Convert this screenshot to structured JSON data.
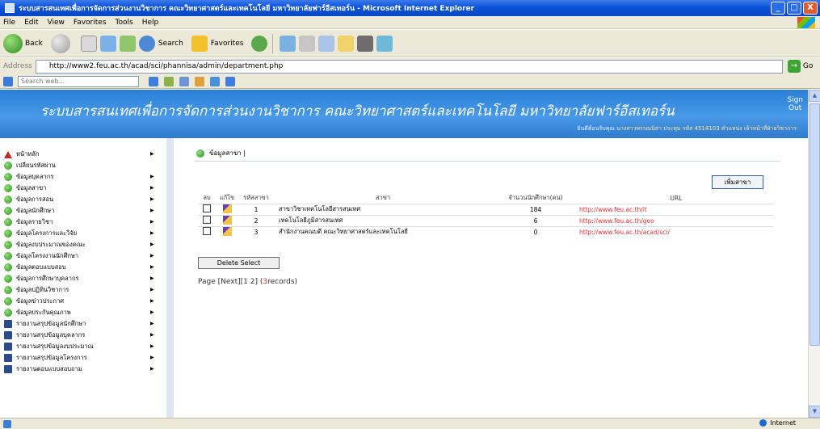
{
  "window": {
    "title": "ระบบสารสนเทศเพื่อการจัดการส่วนงานวิชาการ คณะวิทยาศาสตร์และเทคโนโลยี มหาวิทยาลัยฟาร์อีสเทอร์น - Microsoft Internet Explorer",
    "minimize": "_",
    "maximize": "□",
    "close": "X"
  },
  "menubar": [
    "File",
    "Edit",
    "View",
    "Favorites",
    "Tools",
    "Help"
  ],
  "toolbar": {
    "back": "Back",
    "search": "Search",
    "favorites": "Favorites"
  },
  "address": {
    "label": "Address",
    "url": "http://www2.feu.ac.th/acad/sci/phannisa/admin/department.php",
    "go": "Go"
  },
  "searchbar": {
    "placeholder": "Search web..."
  },
  "header": {
    "site_title": "ระบบสารสนเทศเพื่อการจัดการส่วนงานวิชาการ คณะวิทยาศาสตร์และเทคโนโลยี มหาวิทยาลัยฟาร์อีสเทอร์น",
    "signout_1": "Sign",
    "signout_2": "Out",
    "user_prefix": "ยินดีต้อนรับคุณ",
    "user_info": "นางสาวพรรณนิสา ประทุม รหัส 4514103 ตำแหน่ง เจ้าหน้าที่ฝ่ายวิชาการ"
  },
  "sidebar": {
    "items": [
      {
        "label": "หน้าหลัก",
        "icon": "home-icon",
        "arrow": true
      },
      {
        "label": "เปลี่ยนรหัสผ่าน",
        "icon": "green-dot-icon",
        "arrow": false
      },
      {
        "label": "ข้อมูลบุคลากร",
        "icon": "green-dot-icon",
        "arrow": true
      },
      {
        "label": "ข้อมูลสาขา",
        "icon": "green-dot-icon",
        "arrow": true
      },
      {
        "label": "ข้อมูลการสอน",
        "icon": "green-dot-icon",
        "arrow": true
      },
      {
        "label": "ข้อมูลนักศึกษา",
        "icon": "green-dot-icon",
        "arrow": true
      },
      {
        "label": "ข้อมูลรายวิชา",
        "icon": "green-dot-icon",
        "arrow": true
      },
      {
        "label": "ข้อมูลโครงการและวิจัย",
        "icon": "green-dot-icon",
        "arrow": true
      },
      {
        "label": "ข้อมูลงบประมาณของคณะ",
        "icon": "green-dot-icon",
        "arrow": true
      },
      {
        "label": "ข้อมูลโครงงานนักศึกษา",
        "icon": "green-dot-icon",
        "arrow": true
      },
      {
        "label": "ข้อมูลตอบแบบสอบ",
        "icon": "green-dot-icon",
        "arrow": true
      },
      {
        "label": "ข้อมูลการศึกษาบุคลากร",
        "icon": "green-dot-icon",
        "arrow": true
      },
      {
        "label": "ข้อมูลปฏิทินวิชาการ",
        "icon": "green-dot-icon",
        "arrow": true
      },
      {
        "label": "ข้อมูลข่าวประกาศ",
        "icon": "green-dot-icon",
        "arrow": true
      },
      {
        "label": "ข้อมูลประกันคุณภาพ",
        "icon": "green-dot-icon",
        "arrow": true
      },
      {
        "label": "รายงานสรุปข้อมูลนักศึกษา",
        "icon": "book-icon",
        "arrow": true
      },
      {
        "label": "รายงานสรุปข้อมูลบุคลากร",
        "icon": "book-icon",
        "arrow": true
      },
      {
        "label": "รายงานสรุปข้อมูลงบประมาณ",
        "icon": "book-icon",
        "arrow": true
      },
      {
        "label": "รายงานสรุปข้อมูลโครงการ",
        "icon": "book-icon",
        "arrow": true
      },
      {
        "label": "รายงานตอบแบบสอบถาม",
        "icon": "book-icon",
        "arrow": true
      }
    ]
  },
  "content": {
    "heading": "ข้อมูลสาขา |",
    "add_button": "เพิ่มสาขา",
    "table_headers": [
      "ลบ",
      "แก้ไข",
      "รหัสสาขา",
      "สาขา",
      "จำนวนนักศึกษา(คน)",
      "URL"
    ],
    "rows": [
      {
        "id": "1",
        "name": "สาขาวิชาเทคโนโลยีสารสนเทศ",
        "students": "184",
        "url": "http://www.feu.ac.th/it"
      },
      {
        "id": "2",
        "name": "เทคโนโลยีภูมิสารสนเทศ",
        "students": "6",
        "url": "http://www.feu.ac.th/geo"
      },
      {
        "id": "3",
        "name": "สำนักงานคณบดี คณะวิทยาศาสตร์และเทคโนโลยี",
        "students": "0",
        "url": "http://www.feu.ac.th/acad/sci/"
      }
    ],
    "delete_button": "Delete Select",
    "pager_text": "Page [Next][1 2] (",
    "pager_count": "3",
    "pager_suffix": "records)"
  },
  "status": {
    "zone": "Internet"
  }
}
